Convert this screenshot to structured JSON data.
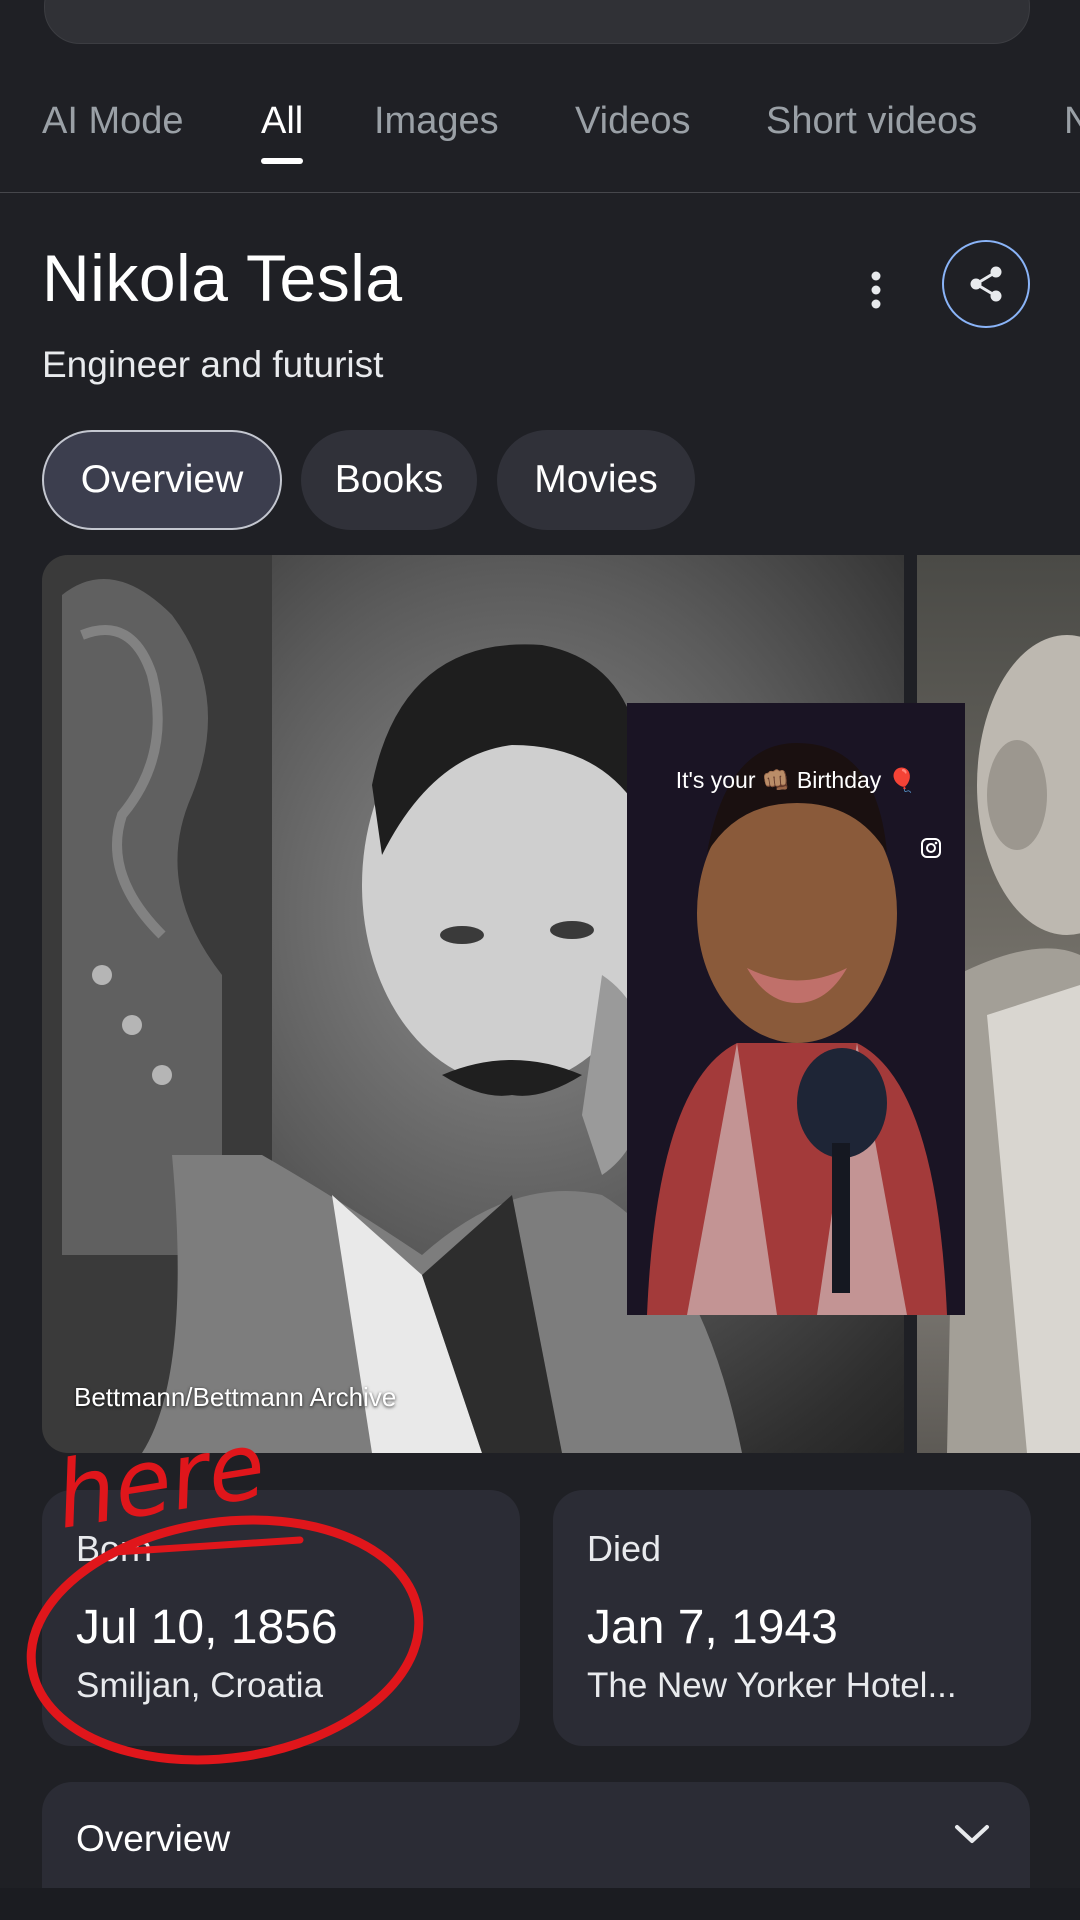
{
  "tabs": [
    {
      "label": "AI Mode",
      "active": false
    },
    {
      "label": "All",
      "active": true
    },
    {
      "label": "Images",
      "active": false
    },
    {
      "label": "Videos",
      "active": false
    },
    {
      "label": "Short videos",
      "active": false
    },
    {
      "label": "N",
      "active": false
    }
  ],
  "entity": {
    "title": "Nikola Tesla",
    "subtitle": "Engineer and futurist"
  },
  "chips": [
    {
      "label": "Overview",
      "selected": true
    },
    {
      "label": "Books",
      "selected": false
    },
    {
      "label": "Movies",
      "selected": false
    }
  ],
  "photo": {
    "credit": "Bettmann/Bettmann Archive"
  },
  "video_overlay": {
    "caption": "It's your 👊🏽 Birthday 🎈"
  },
  "born": {
    "label": "Born",
    "date": "Jul 10, 1856",
    "place": "Smiljan, Croatia"
  },
  "died": {
    "label": "Died",
    "date": "Jan 7, 1943",
    "place": "The New Yorker Hotel..."
  },
  "overview_section": {
    "label": "Overview"
  },
  "annotation": {
    "text": "here",
    "color": "#e0161b"
  },
  "colors": {
    "background": "#1f2025",
    "card": "#2b2c35",
    "accent_blue": "#8ab4f8"
  },
  "icons": {
    "more": "more-vert-icon",
    "share": "share-icon",
    "instagram": "instagram-icon",
    "expand": "chevron-down-icon"
  }
}
